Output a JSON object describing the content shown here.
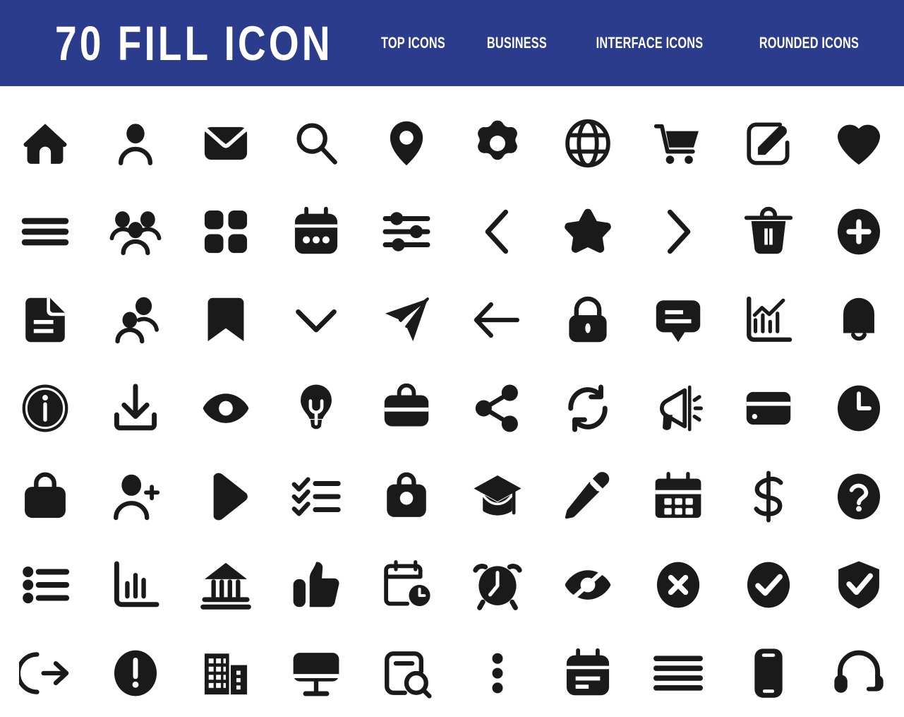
{
  "header": {
    "title": "70 FILL ICON",
    "background_color": "#2c3c8c",
    "text_color": "#ffffff",
    "nav": [
      {
        "label": "TOP ICONS"
      },
      {
        "label": "BUSINESS"
      },
      {
        "label": "INTERFACE ICONS"
      },
      {
        "label": "ROUNDED ICONS"
      }
    ]
  },
  "page": {
    "background_color": "#ffffff",
    "icon_color": "#1a1a1a",
    "columns": 10,
    "rows": 7,
    "icon_count": 70
  },
  "icons": [
    {
      "name": "home-icon",
      "label": "home"
    },
    {
      "name": "user-icon",
      "label": "user"
    },
    {
      "name": "mail-icon",
      "label": "mail"
    },
    {
      "name": "search-icon",
      "label": "search"
    },
    {
      "name": "location-pin-icon",
      "label": "location"
    },
    {
      "name": "gear-icon",
      "label": "settings"
    },
    {
      "name": "globe-icon",
      "label": "globe"
    },
    {
      "name": "shopping-cart-icon",
      "label": "cart"
    },
    {
      "name": "edit-square-icon",
      "label": "edit"
    },
    {
      "name": "heart-icon",
      "label": "heart"
    },
    {
      "name": "hamburger-menu-icon",
      "label": "menu"
    },
    {
      "name": "users-group-icon",
      "label": "group"
    },
    {
      "name": "grid-icon",
      "label": "grid"
    },
    {
      "name": "calendar-dots-icon",
      "label": "calendar"
    },
    {
      "name": "sliders-icon",
      "label": "filters"
    },
    {
      "name": "chevron-left-icon",
      "label": "previous"
    },
    {
      "name": "star-icon",
      "label": "star"
    },
    {
      "name": "chevron-right-icon",
      "label": "next"
    },
    {
      "name": "trash-icon",
      "label": "delete"
    },
    {
      "name": "plus-circle-icon",
      "label": "add"
    },
    {
      "name": "document-icon",
      "label": "document"
    },
    {
      "name": "two-users-icon",
      "label": "contacts"
    },
    {
      "name": "bookmark-icon",
      "label": "bookmark"
    },
    {
      "name": "chevron-down-icon",
      "label": "expand"
    },
    {
      "name": "send-icon",
      "label": "send"
    },
    {
      "name": "arrow-left-icon",
      "label": "back"
    },
    {
      "name": "lock-icon",
      "label": "lock"
    },
    {
      "name": "chat-bubble-icon",
      "label": "chat"
    },
    {
      "name": "analytics-chart-icon",
      "label": "analytics"
    },
    {
      "name": "bell-icon",
      "label": "notifications"
    },
    {
      "name": "info-circle-icon",
      "label": "info"
    },
    {
      "name": "download-icon",
      "label": "download"
    },
    {
      "name": "eye-icon",
      "label": "view"
    },
    {
      "name": "lightbulb-icon",
      "label": "idea"
    },
    {
      "name": "briefcase-icon",
      "label": "briefcase"
    },
    {
      "name": "share-icon",
      "label": "share"
    },
    {
      "name": "refresh-icon",
      "label": "refresh"
    },
    {
      "name": "megaphone-icon",
      "label": "announce"
    },
    {
      "name": "credit-card-icon",
      "label": "payment"
    },
    {
      "name": "clock-icon",
      "label": "time"
    },
    {
      "name": "shopping-bag-icon",
      "label": "bag"
    },
    {
      "name": "add-user-icon",
      "label": "add user"
    },
    {
      "name": "play-icon",
      "label": "play"
    },
    {
      "name": "checklist-icon",
      "label": "tasks"
    },
    {
      "name": "handbag-icon",
      "label": "handbag"
    },
    {
      "name": "graduation-cap-icon",
      "label": "education"
    },
    {
      "name": "pencil-icon",
      "label": "write"
    },
    {
      "name": "calendar-grid-icon",
      "label": "schedule"
    },
    {
      "name": "dollar-icon",
      "label": "dollar"
    },
    {
      "name": "question-circle-icon",
      "label": "help"
    },
    {
      "name": "bullet-list-icon",
      "label": "list"
    },
    {
      "name": "bar-chart-icon",
      "label": "chart"
    },
    {
      "name": "bank-icon",
      "label": "bank"
    },
    {
      "name": "thumbs-up-icon",
      "label": "like"
    },
    {
      "name": "calendar-clock-icon",
      "label": "event time"
    },
    {
      "name": "alarm-clock-icon",
      "label": "alarm"
    },
    {
      "name": "eye-slash-icon",
      "label": "hidden"
    },
    {
      "name": "x-circle-icon",
      "label": "close"
    },
    {
      "name": "check-circle-icon",
      "label": "done"
    },
    {
      "name": "shield-check-icon",
      "label": "secure"
    },
    {
      "name": "logout-icon",
      "label": "logout"
    },
    {
      "name": "exclamation-circle-icon",
      "label": "alert"
    },
    {
      "name": "buildings-icon",
      "label": "office"
    },
    {
      "name": "monitor-icon",
      "label": "desktop"
    },
    {
      "name": "document-search-icon",
      "label": "find document"
    },
    {
      "name": "kebab-menu-icon",
      "label": "more"
    },
    {
      "name": "calendar-note-icon",
      "label": "note"
    },
    {
      "name": "lines-list-icon",
      "label": "lines"
    },
    {
      "name": "smartphone-icon",
      "label": "mobile"
    },
    {
      "name": "headset-icon",
      "label": "support"
    }
  ]
}
